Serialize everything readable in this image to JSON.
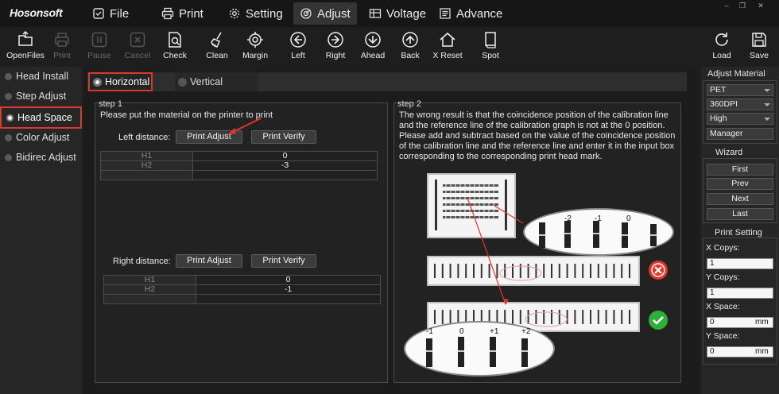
{
  "app": {
    "logo": "Hosonsoft"
  },
  "menu": [
    {
      "label": "File",
      "icon": "file-check-icon"
    },
    {
      "label": "Print",
      "icon": "printer-icon"
    },
    {
      "label": "Setting",
      "icon": "gear-icon"
    },
    {
      "label": "Adjust",
      "icon": "adjust-icon",
      "active": true
    },
    {
      "label": "Voltage",
      "icon": "voltage-icon"
    },
    {
      "label": "Advance",
      "icon": "advance-icon"
    }
  ],
  "toolbar": {
    "openfiles": "OpenFiles",
    "print": "Print",
    "pause": "Pause",
    "cancel": "Cancel",
    "check": "Check",
    "clean": "Clean",
    "margin": "Margin",
    "left": "Left",
    "right": "Right",
    "ahead": "Ahead",
    "back": "Back",
    "xreset": "X Reset",
    "spot": "Spot",
    "load": "Load",
    "save": "Save"
  },
  "sidebar": {
    "items": [
      {
        "label": "Head Install"
      },
      {
        "label": "Step Adjust"
      },
      {
        "label": "Head Space",
        "selected": true
      },
      {
        "label": "Color Adjust"
      },
      {
        "label": "Bidirec Adjust"
      }
    ]
  },
  "tabs": {
    "horizontal": "Horizontal",
    "vertical": "Vertical"
  },
  "step1": {
    "title": "step 1",
    "instruction": "Please put the material on the printer to print",
    "left_label": "Left distance:",
    "right_label": "Right distance:",
    "print_adjust": "Print Adjust",
    "print_verify": "Print Verify",
    "left_table": [
      [
        "H1",
        "0"
      ],
      [
        "H2",
        "-3"
      ],
      [
        "",
        ""
      ]
    ],
    "right_table": [
      [
        "H1",
        "0"
      ],
      [
        "H2",
        "-1"
      ],
      [
        "",
        ""
      ]
    ]
  },
  "step2": {
    "title": "step 2",
    "lines": [
      "The wrong result is that the coincidence position of the calibration line",
      "and the reference line of the calibration graph is not at the 0 position.",
      "Please add and subtract based on the value of the coincidence position",
      "of the calibration line and the reference line and enter it in the input box",
      "corresponding to the corresponding print head mark."
    ],
    "zoom_top_labels": [
      "-2",
      "-1",
      "0"
    ],
    "zoom_bottom_labels": [
      "-1",
      "0",
      "+1",
      "+2"
    ]
  },
  "right": {
    "adjust_material_title": "Adjust Material",
    "material": "PET",
    "dpi": "360DPI",
    "quality": "High",
    "manager": "Manager",
    "wizard_title": "Wizard",
    "first": "First",
    "prev": "Prev",
    "next": "Next",
    "last": "Last",
    "print_setting_title": "Print Setting",
    "x_copys_label": "X Copys:",
    "x_copys": "1",
    "y_copys_label": "Y Copys:",
    "y_copys": "1",
    "x_space_label": "X Space:",
    "x_space": "0",
    "y_space_label": "Y Space:",
    "y_space": "0",
    "unit": "mm"
  },
  "colors": {
    "highlight": "#d63a2f",
    "wrong": "#e0352b",
    "correct": "#2fae3a"
  }
}
